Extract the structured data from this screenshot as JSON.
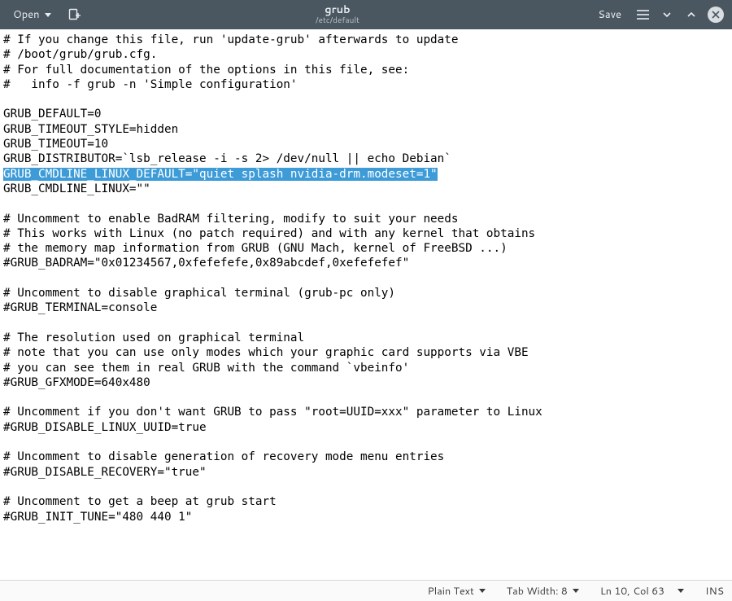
{
  "header": {
    "open_label": "Open",
    "save_label": "Save",
    "filename": "grub",
    "filepath": "/etc/default"
  },
  "editor": {
    "lines": [
      "# If you change this file, run 'update-grub' afterwards to update",
      "# /boot/grub/grub.cfg.",
      "# For full documentation of the options in this file, see:",
      "#   info -f grub -n 'Simple configuration'",
      "",
      "GRUB_DEFAULT=0",
      "GRUB_TIMEOUT_STYLE=hidden",
      "GRUB_TIMEOUT=10",
      "GRUB_DISTRIBUTOR=`lsb_release -i -s 2> /dev/null || echo Debian`",
      "GRUB_CMDLINE_LINUX_DEFAULT=\"quiet splash nvidia-drm.modeset=1\"",
      "GRUB_CMDLINE_LINUX=\"\"",
      "",
      "# Uncomment to enable BadRAM filtering, modify to suit your needs",
      "# This works with Linux (no patch required) and with any kernel that obtains",
      "# the memory map information from GRUB (GNU Mach, kernel of FreeBSD ...)",
      "#GRUB_BADRAM=\"0x01234567,0xfefefefe,0x89abcdef,0xefefefef\"",
      "",
      "# Uncomment to disable graphical terminal (grub-pc only)",
      "#GRUB_TERMINAL=console",
      "",
      "# The resolution used on graphical terminal",
      "# note that you can use only modes which your graphic card supports via VBE",
      "# you can see them in real GRUB with the command `vbeinfo'",
      "#GRUB_GFXMODE=640x480",
      "",
      "# Uncomment if you don't want GRUB to pass \"root=UUID=xxx\" parameter to Linux",
      "#GRUB_DISABLE_LINUX_UUID=true",
      "",
      "# Uncomment to disable generation of recovery mode menu entries",
      "#GRUB_DISABLE_RECOVERY=\"true\"",
      "",
      "# Uncomment to get a beep at grub start",
      "#GRUB_INIT_TUNE=\"480 440 1\""
    ],
    "selection_line_index": 9
  },
  "statusbar": {
    "language": "Plain Text",
    "tab_width_label": "Tab Width: 8",
    "cursor": "Ln 10, Col 63",
    "insert_mode": "INS"
  }
}
